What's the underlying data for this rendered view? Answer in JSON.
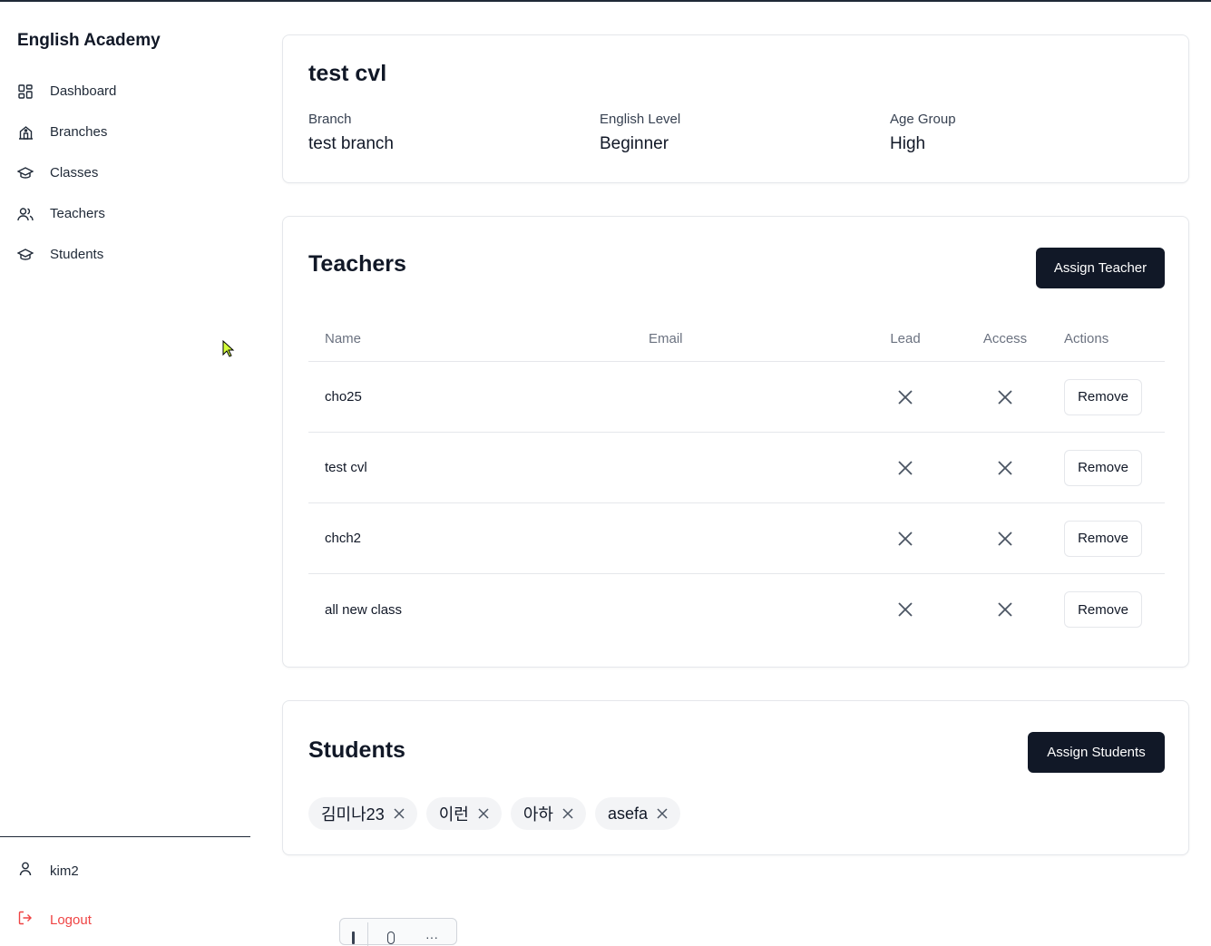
{
  "app": {
    "brand": "English Academy"
  },
  "sidebar": {
    "items": [
      {
        "label": "Dashboard",
        "icon": "dashboard-icon"
      },
      {
        "label": "Branches",
        "icon": "building-icon"
      },
      {
        "label": "Classes",
        "icon": "graduation-cap-icon"
      },
      {
        "label": "Teachers",
        "icon": "users-icon"
      },
      {
        "label": "Students",
        "icon": "graduation-cap-icon"
      }
    ],
    "user": {
      "name": "kim2",
      "icon": "user-icon"
    },
    "logout": {
      "label": "Logout",
      "icon": "logout-icon",
      "color": "#ef4444"
    }
  },
  "class_info": {
    "title": "test cvl",
    "fields": [
      {
        "label": "Branch",
        "value": "test branch"
      },
      {
        "label": "English Level",
        "value": "Beginner"
      },
      {
        "label": "Age Group",
        "value": "High"
      }
    ]
  },
  "teachers": {
    "title": "Teachers",
    "assign_label": "Assign Teacher",
    "columns": {
      "name": "Name",
      "email": "Email",
      "lead": "Lead",
      "access": "Access",
      "actions": "Actions"
    },
    "rows": [
      {
        "name": "cho25",
        "email": "",
        "lead": false,
        "access": false,
        "action": "Remove"
      },
      {
        "name": "test cvl",
        "email": "",
        "lead": false,
        "access": false,
        "action": "Remove"
      },
      {
        "name": "chch2",
        "email": "",
        "lead": false,
        "access": false,
        "action": "Remove"
      },
      {
        "name": "all new class",
        "email": "",
        "lead": false,
        "access": false,
        "action": "Remove"
      }
    ]
  },
  "students": {
    "title": "Students",
    "assign_label": "Assign Students",
    "chips": [
      "김미나23",
      "이런",
      "아하",
      "asefa"
    ]
  },
  "colors": {
    "primary_button": "#111827",
    "border": "#e5e7eb",
    "chip_bg": "#f3f4f6"
  }
}
